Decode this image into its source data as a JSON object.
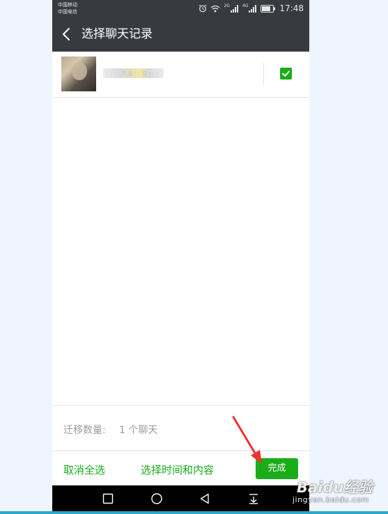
{
  "status_bar": {
    "carrier_1": "中国移动",
    "carrier_2": "中国电信",
    "network_1": "2G",
    "network_2": "4G",
    "time": "17:48",
    "icons": [
      "alarm-icon",
      "wifi-icon",
      "signal-icon",
      "signal-icon",
      "battery-icon"
    ]
  },
  "header": {
    "title": "选择聊天记录"
  },
  "chat_list": [
    {
      "name": "· · ng· g· ·",
      "selected": true
    }
  ],
  "summary": {
    "count_label": "迁移数量:",
    "count_value": "1 个聊天"
  },
  "actions": {
    "deselect_all": "取消全选",
    "select_time_content": "选择时间和内容",
    "done": "完成"
  },
  "watermark": {
    "brand": "Baidu经验",
    "site": "jingyan.baidu.com"
  },
  "colors": {
    "header_bg": "#393a3f",
    "accent_green": "#1aad19",
    "annotation_red": "#f03030"
  }
}
